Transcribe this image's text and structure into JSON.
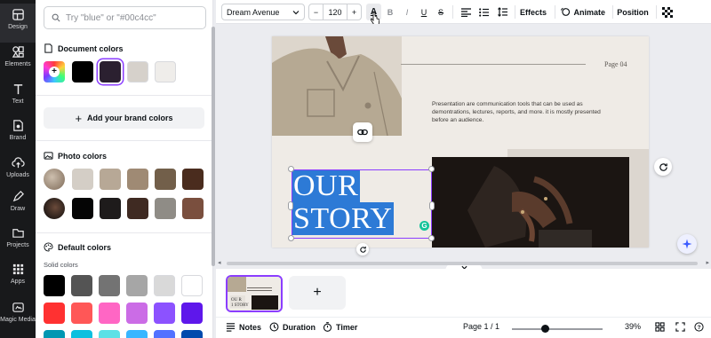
{
  "rail": {
    "items": [
      {
        "label": "Design",
        "icon": "design-icon"
      },
      {
        "label": "Elements",
        "icon": "elements-icon"
      },
      {
        "label": "Text",
        "icon": "text-icon"
      },
      {
        "label": "Brand",
        "icon": "brand-icon"
      },
      {
        "label": "Uploads",
        "icon": "uploads-icon"
      },
      {
        "label": "Draw",
        "icon": "draw-icon"
      },
      {
        "label": "Projects",
        "icon": "projects-icon"
      },
      {
        "label": "Apps",
        "icon": "apps-icon"
      },
      {
        "label": "Magic Media",
        "icon": "magic-media-icon"
      }
    ]
  },
  "panel": {
    "search_placeholder": "Try \"blue\" or \"#00c4cc\"",
    "document_colors_title": "Document colors",
    "document_colors": [
      "#000000",
      "#2b2030",
      "#d6d1cb",
      "#efedea"
    ],
    "add_brand_colors": "Add your brand colors",
    "photo_colors_title": "Photo colors",
    "photo_colors_row1": [
      "#d4cec6",
      "#b7a896",
      "#9f8a74",
      "#725f4a",
      "#4a2c1e"
    ],
    "photo_colors_row2": [
      "#050505",
      "#1e1b1b",
      "#3f2a22",
      "#8f8c86",
      "#7a4f3e"
    ],
    "default_colors_title": "Default colors",
    "solid_colors_label": "Solid colors",
    "default_row1": [
      "#000000",
      "#545454",
      "#737373",
      "#a6a6a6",
      "#d9d9d9",
      "#ffffff"
    ],
    "default_row2": [
      "#ff3131",
      "#ff5757",
      "#ff66c4",
      "#cb6ce6",
      "#8c52ff",
      "#5e17eb"
    ],
    "default_row3": [
      "#0097b2",
      "#0cc0df",
      "#5ce1e6",
      "#38b6ff",
      "#5271ff",
      "#004aad"
    ]
  },
  "toolbar": {
    "font": "Dream Avenue",
    "font_size": "120",
    "minus": "−",
    "plus": "+",
    "text_color_icon": "A",
    "bold": "B",
    "italic": "I",
    "underline": "U",
    "strike": "S",
    "effects": "Effects",
    "animate": "Animate",
    "position": "Position"
  },
  "design": {
    "page_label": "Page 04",
    "description": "Presentation are communication tools that can be used as demontrations, lectures, reports, and more. it is mostly presented before an audience.",
    "title_line1": "OUR",
    "title_line2": "STORY"
  },
  "thumbs": {
    "add_page": "+"
  },
  "footer": {
    "notes": "Notes",
    "duration": "Duration",
    "timer": "Timer",
    "page_indicator": "Page 1 / 1",
    "zoom": "39%",
    "zoom_level": 0.39
  },
  "colors": {
    "accent": "#8b3dff",
    "selection_fill": "#2d7ad6",
    "rail_bg": "#18191b"
  }
}
